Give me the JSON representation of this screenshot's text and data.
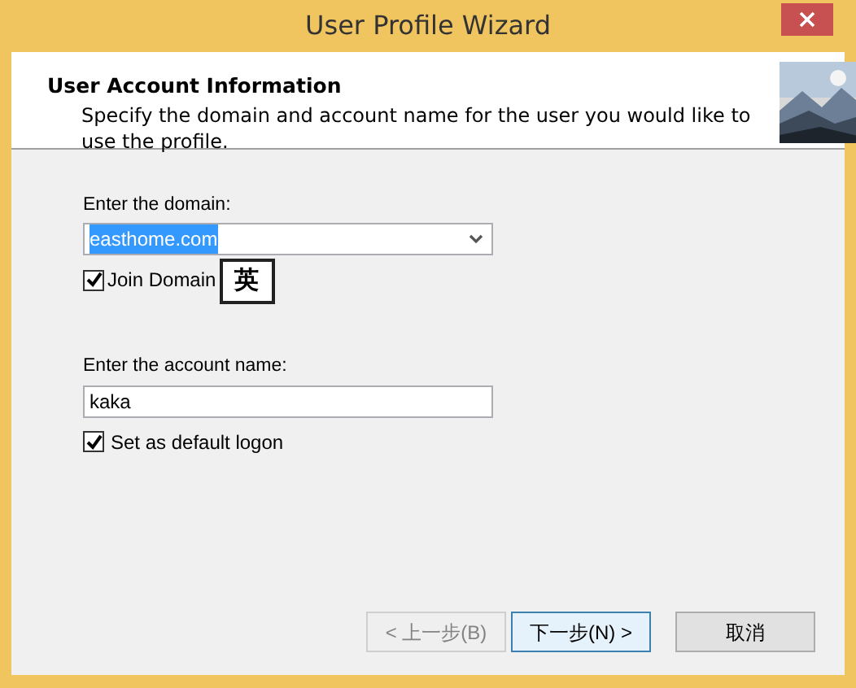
{
  "window": {
    "title": "User Profile Wizard"
  },
  "header": {
    "title": "User Account Information",
    "description": "Specify the domain and account name for the user you would like to use the profile."
  },
  "domain": {
    "label": "Enter the domain:",
    "value": "easthome.com",
    "text_selected": true
  },
  "join_domain": {
    "label": "Join Domain",
    "checked": true
  },
  "ime_indicator": {
    "text": "英"
  },
  "account": {
    "label": "Enter the account name:",
    "value": "kaka"
  },
  "default_logon": {
    "label": "Set as default logon",
    "checked": true
  },
  "buttons": [
    {
      "label": "< 上一步(B)",
      "disabled": true,
      "focused": false
    },
    {
      "label": "下一步(N) >",
      "disabled": false,
      "focused": true
    },
    {
      "label": "取消",
      "disabled": false,
      "focused": false
    }
  ]
}
